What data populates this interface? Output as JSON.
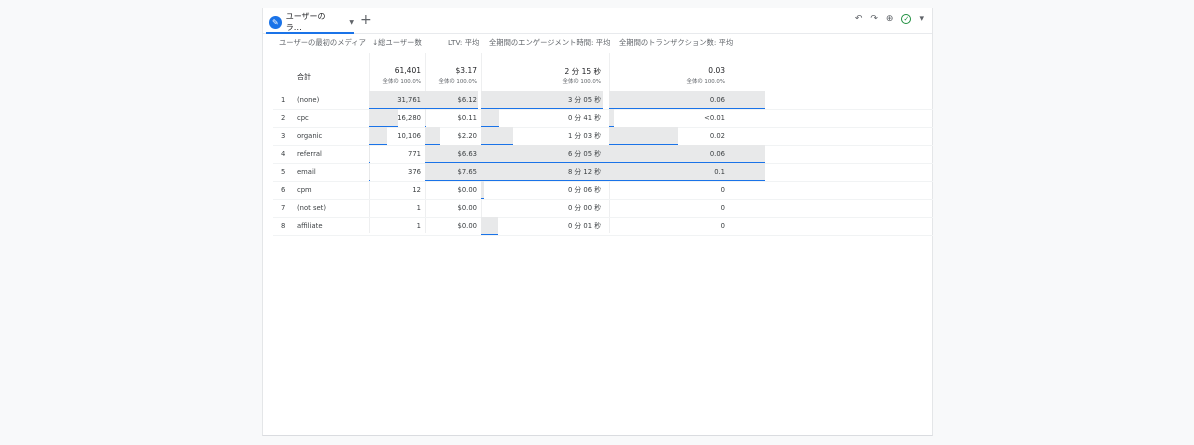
{
  "toolbar": {
    "tab_label": "ユーザーのラ…",
    "tab_caret": "▼",
    "add_tab": "+",
    "undo": "↶",
    "redo": "↷",
    "share": "⊕",
    "status": "✓",
    "status_caret": "▾"
  },
  "table": {
    "headers": {
      "dimension": "ユーザーの最初のメディア",
      "total_users": "↓総ユーザー数",
      "ltv": "LTV: 平均",
      "engagement": "全期間のエンゲージメント時間: 平均",
      "transactions": "全期間のトランザクション数: 平均"
    },
    "totals": {
      "label": "合計",
      "total_users": "61,401",
      "total_users_sub": "全体の 100.0%",
      "ltv": "$3.17",
      "ltv_sub": "全体の 100.0%",
      "engagement": "2 分 15 秒",
      "engagement_sub": "全体の 100.0%",
      "transactions": "0.03",
      "transactions_sub": "全体の 100.0%"
    },
    "rows": [
      {
        "index": "1",
        "medium": "(none)",
        "users": "31,761",
        "ltv": "$6.12",
        "engagement": "3 分 05 秒",
        "transactions": "0.06",
        "users_frac": 1.0,
        "ltv_frac": 0.95,
        "eng_frac": 0.95,
        "tr_frac": 1.0
      },
      {
        "index": "2",
        "medium": "cpc",
        "users": "16,280",
        "ltv": "$0.11",
        "engagement": "0 分 41 秒",
        "transactions": "<0.01",
        "users_frac": 0.52,
        "ltv_frac": 0.02,
        "eng_frac": 0.14,
        "tr_frac": 0.03
      },
      {
        "index": "3",
        "medium": "organic",
        "users": "10,106",
        "ltv": "$2.20",
        "engagement": "1 分 03 秒",
        "transactions": "0.02",
        "users_frac": 0.32,
        "ltv_frac": 0.27,
        "eng_frac": 0.25,
        "tr_frac": 0.44
      },
      {
        "index": "4",
        "medium": "referral",
        "users": "771",
        "ltv": "$6.63",
        "engagement": "6 分 05 秒",
        "transactions": "0.06",
        "users_frac": 0.02,
        "ltv_frac": 1.0,
        "eng_frac": 1.0,
        "tr_frac": 1.0
      },
      {
        "index": "5",
        "medium": "email",
        "users": "376",
        "ltv": "$7.65",
        "engagement": "8 分 12 秒",
        "transactions": "0.1",
        "users_frac": 0.01,
        "ltv_frac": 1.0,
        "eng_frac": 1.0,
        "tr_frac": 1.0
      },
      {
        "index": "6",
        "medium": "cpm",
        "users": "12",
        "ltv": "$0.00",
        "engagement": "0 分 06 秒",
        "transactions": "0",
        "users_frac": 0.0,
        "ltv_frac": 0.0,
        "eng_frac": 0.02,
        "tr_frac": 0.0
      },
      {
        "index": "7",
        "medium": "(not set)",
        "users": "1",
        "ltv": "$0.00",
        "engagement": "0 分 00 秒",
        "transactions": "0",
        "users_frac": 0.0,
        "ltv_frac": 0.0,
        "eng_frac": 0.0,
        "tr_frac": 0.0
      },
      {
        "index": "8",
        "medium": "affiliate",
        "users": "1",
        "ltv": "$0.00",
        "engagement": "0 分 01 秒",
        "transactions": "0",
        "users_frac": 0.0,
        "ltv_frac": 0.0,
        "eng_frac": 0.13,
        "tr_frac": 0.0
      }
    ]
  },
  "colors": {
    "accent": "#1a73e8",
    "bar_fill": "#e8e9ea",
    "ok": "#1e8e3e"
  }
}
